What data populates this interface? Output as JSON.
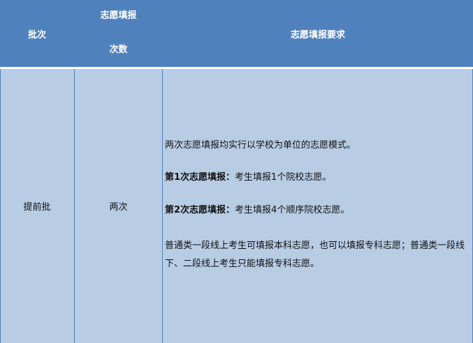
{
  "table": {
    "headers": {
      "batch": "批次",
      "times_line1": "志愿填报",
      "times_line2": "次数",
      "requirements": "志愿填报要求"
    },
    "row": {
      "batch": "提前批",
      "times": "两次",
      "req_intro": "两次志愿填报均实行以学校为单位的志愿模式。",
      "req_first_label": "第1次志愿填报：",
      "req_first_text": "考生填报1个院校志愿。",
      "req_second_label": "第2次志愿填报：",
      "req_second_text": "考生填报4个顺序院校志愿。",
      "req_note": "普通类一段线上考生可填报本科志愿，也可以填报专科志愿；普通类一段线下、二段线上考生只能填报专科志愿。"
    }
  },
  "colors": {
    "header_bg": "#4f81bd",
    "row_bg": "#b8cce4",
    "header_text": "#ffffff"
  }
}
